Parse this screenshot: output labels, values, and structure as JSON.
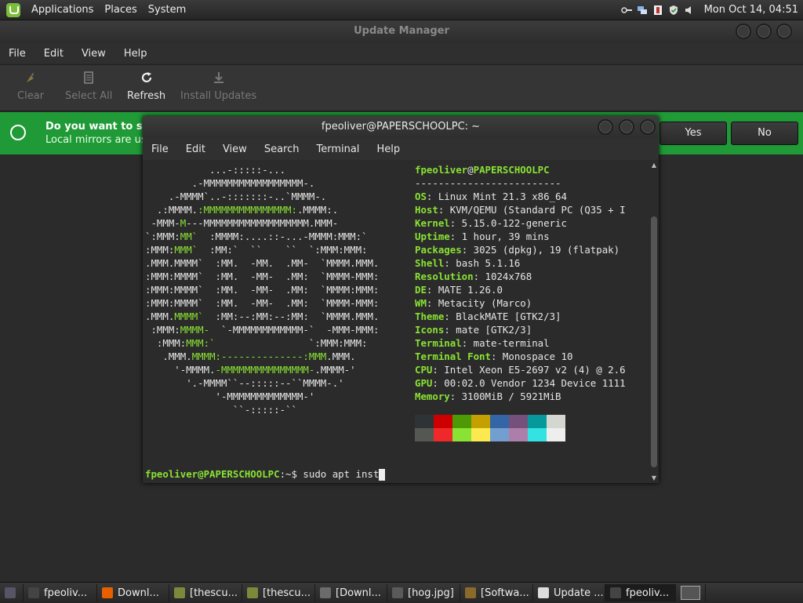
{
  "top_panel": {
    "menu": [
      "Applications",
      "Places",
      "System"
    ],
    "tray_icons": [
      "key-icon",
      "network-icon",
      "clipboard-icon",
      "shield-icon",
      "volume-icon"
    ],
    "clock": "Mon Oct 14, 04:51"
  },
  "update_manager": {
    "title": "Update Manager",
    "menu": [
      "File",
      "Edit",
      "View",
      "Help"
    ],
    "toolbar": {
      "clear": "Clear",
      "select_all": "Select All",
      "refresh": "Refresh",
      "install_updates": "Install Updates"
    },
    "infobar": {
      "line1": "Do you want to swit",
      "line2": "Local mirrors are usu",
      "yes": "Yes",
      "no": "No"
    }
  },
  "terminal": {
    "title": "fpeoliver@PAPERSCHOOLPC: ~",
    "menu": [
      "File",
      "Edit",
      "View",
      "Search",
      "Terminal",
      "Help"
    ],
    "neofetch": {
      "user": "fpeoliver",
      "at": "@",
      "host": "PAPERSCHOOLPC",
      "separator": "-------------------------",
      "fields": [
        {
          "k": "OS",
          "v": "Linux Mint 21.3 x86_64"
        },
        {
          "k": "Host",
          "v": "KVM/QEMU (Standard PC (Q35 + I"
        },
        {
          "k": "Kernel",
          "v": "5.15.0-122-generic"
        },
        {
          "k": "Uptime",
          "v": "1 hour, 39 mins"
        },
        {
          "k": "Packages",
          "v": "3025 (dpkg), 19 (flatpak)"
        },
        {
          "k": "Shell",
          "v": "bash 5.1.16"
        },
        {
          "k": "Resolution",
          "v": "1024x768"
        },
        {
          "k": "DE",
          "v": "MATE 1.26.0"
        },
        {
          "k": "WM",
          "v": "Metacity (Marco)"
        },
        {
          "k": "Theme",
          "v": "BlackMATE [GTK2/3]"
        },
        {
          "k": "Icons",
          "v": "mate [GTK2/3]"
        },
        {
          "k": "Terminal",
          "v": "mate-terminal"
        },
        {
          "k": "Terminal Font",
          "v": "Monospace 10"
        },
        {
          "k": "CPU",
          "v": "Intel Xeon E5-2697 v2 (4) @ 2.6"
        },
        {
          "k": "GPU",
          "v": "00:02.0 Vendor 1234 Device 1111"
        },
        {
          "k": "Memory",
          "v": "3100MiB / 5921MiB"
        }
      ],
      "palette": [
        "#2e3436",
        "#cc0000",
        "#4e9a06",
        "#c4a000",
        "#3465a4",
        "#75507b",
        "#06989a",
        "#d3d7cf",
        "#555753",
        "#ef2929",
        "#8ae234",
        "#fce94f",
        "#729fcf",
        "#ad7fa8",
        "#34e2e2",
        "#eeeeec"
      ]
    },
    "ascii_art": [
      [
        [
          "w",
          "           ...-:::::-..."
        ]
      ],
      [
        [
          "w",
          "        .-MMMMMMMMMMMMMMMMM-."
        ]
      ],
      [
        [
          "w",
          "    .-MMMM`..-:::::::-..`MMMM-."
        ]
      ],
      [
        [
          "w",
          "  .:MMMM."
        ],
        [
          "g",
          ":MMMMMMMMMMMMMMM:"
        ],
        [
          "w",
          ".MMMM:."
        ]
      ],
      [
        [
          "w",
          " -MMM-"
        ],
        [
          "g",
          "M"
        ],
        [
          "w",
          "---MMMMMMMMMMMMMMMMMM.MMM-"
        ]
      ],
      [
        [
          "w",
          "`:MMM:"
        ],
        [
          "g",
          "MM`"
        ],
        [
          "w",
          "  :MMMM:....::-...-MMMM:MMM:`"
        ]
      ],
      [
        [
          "w",
          ":MMM:"
        ],
        [
          "g",
          "MMM`"
        ],
        [
          "w",
          "  :MM:`  ``    ``  `:MMM:MMM:"
        ]
      ],
      [
        [
          "w",
          ".MMM.MMMM`  :MM.  -MM.  .MM-  `MMMM.MMM."
        ]
      ],
      [
        [
          "w",
          ":MMM:MMMM`  :MM.  -MM-  .MM:  `MMMM-MMM:"
        ]
      ],
      [
        [
          "w",
          ":MMM:MMMM`  :MM.  -MM-  .MM:  `MMMM:MMM:"
        ]
      ],
      [
        [
          "w",
          ":MMM:MMMM`  :MM.  -MM-  .MM:  `MMMM-MMM:"
        ]
      ],
      [
        [
          "w",
          ".MMM."
        ],
        [
          "g",
          "MMMM`"
        ],
        [
          "w",
          "  :MM:--:MM:--:MM:  `MMMM.MMM."
        ]
      ],
      [
        [
          "w",
          " :MMM:"
        ],
        [
          "g",
          "MMMM-"
        ],
        [
          "w",
          "  `-MMMMMMMMMMMM-`  -MMM-MMM:"
        ]
      ],
      [
        [
          "w",
          "  :MMM:"
        ],
        [
          "g",
          "MMM:`"
        ],
        [
          "w",
          "                `:MMM:MMM:"
        ]
      ],
      [
        [
          "w",
          "   .MMM."
        ],
        [
          "g",
          "MMMM:--------------:MMM"
        ],
        [
          "w",
          ".MMM."
        ]
      ],
      [
        [
          "w",
          "     '-MMMM."
        ],
        [
          "g",
          "-MMMMMMMMMMMMMMM-"
        ],
        [
          "w",
          ".MMMM-'"
        ]
      ],
      [
        [
          "w",
          "       '.-MMMM``--:::::--``MMMM-.'"
        ]
      ],
      [
        [
          "w",
          "            '-MMMMMMMMMMMMM-'"
        ]
      ],
      [
        [
          "w",
          "               ``-:::::-``"
        ]
      ]
    ],
    "prompt": {
      "user_host": "fpeoliver@PAPERSCHOOLPC",
      "path": ":~$ ",
      "command": "sudo apt inst"
    }
  },
  "taskbar": {
    "tasks": [
      {
        "label": "fpeoliv...",
        "icon": "terminal-icon",
        "color": "#444"
      },
      {
        "label": "Downl...",
        "icon": "firefox-icon",
        "color": "#e66000"
      },
      {
        "label": "[thescu...",
        "icon": "image-icon",
        "color": "#7a8a3a"
      },
      {
        "label": "[thescu...",
        "icon": "image-icon",
        "color": "#7a8a3a"
      },
      {
        "label": "[Downl...",
        "icon": "folder-icon",
        "color": "#6b6b6b"
      },
      {
        "label": "[hog.jpg]",
        "icon": "image-viewer-icon",
        "color": "#5a5a5a"
      },
      {
        "label": "[Softwa...",
        "icon": "software-icon",
        "color": "#8a6a2a"
      },
      {
        "label": "Update ...",
        "icon": "shield-icon",
        "color": "#dddddd"
      },
      {
        "label": "fpeoliv...",
        "icon": "terminal-icon",
        "color": "#444"
      }
    ]
  }
}
